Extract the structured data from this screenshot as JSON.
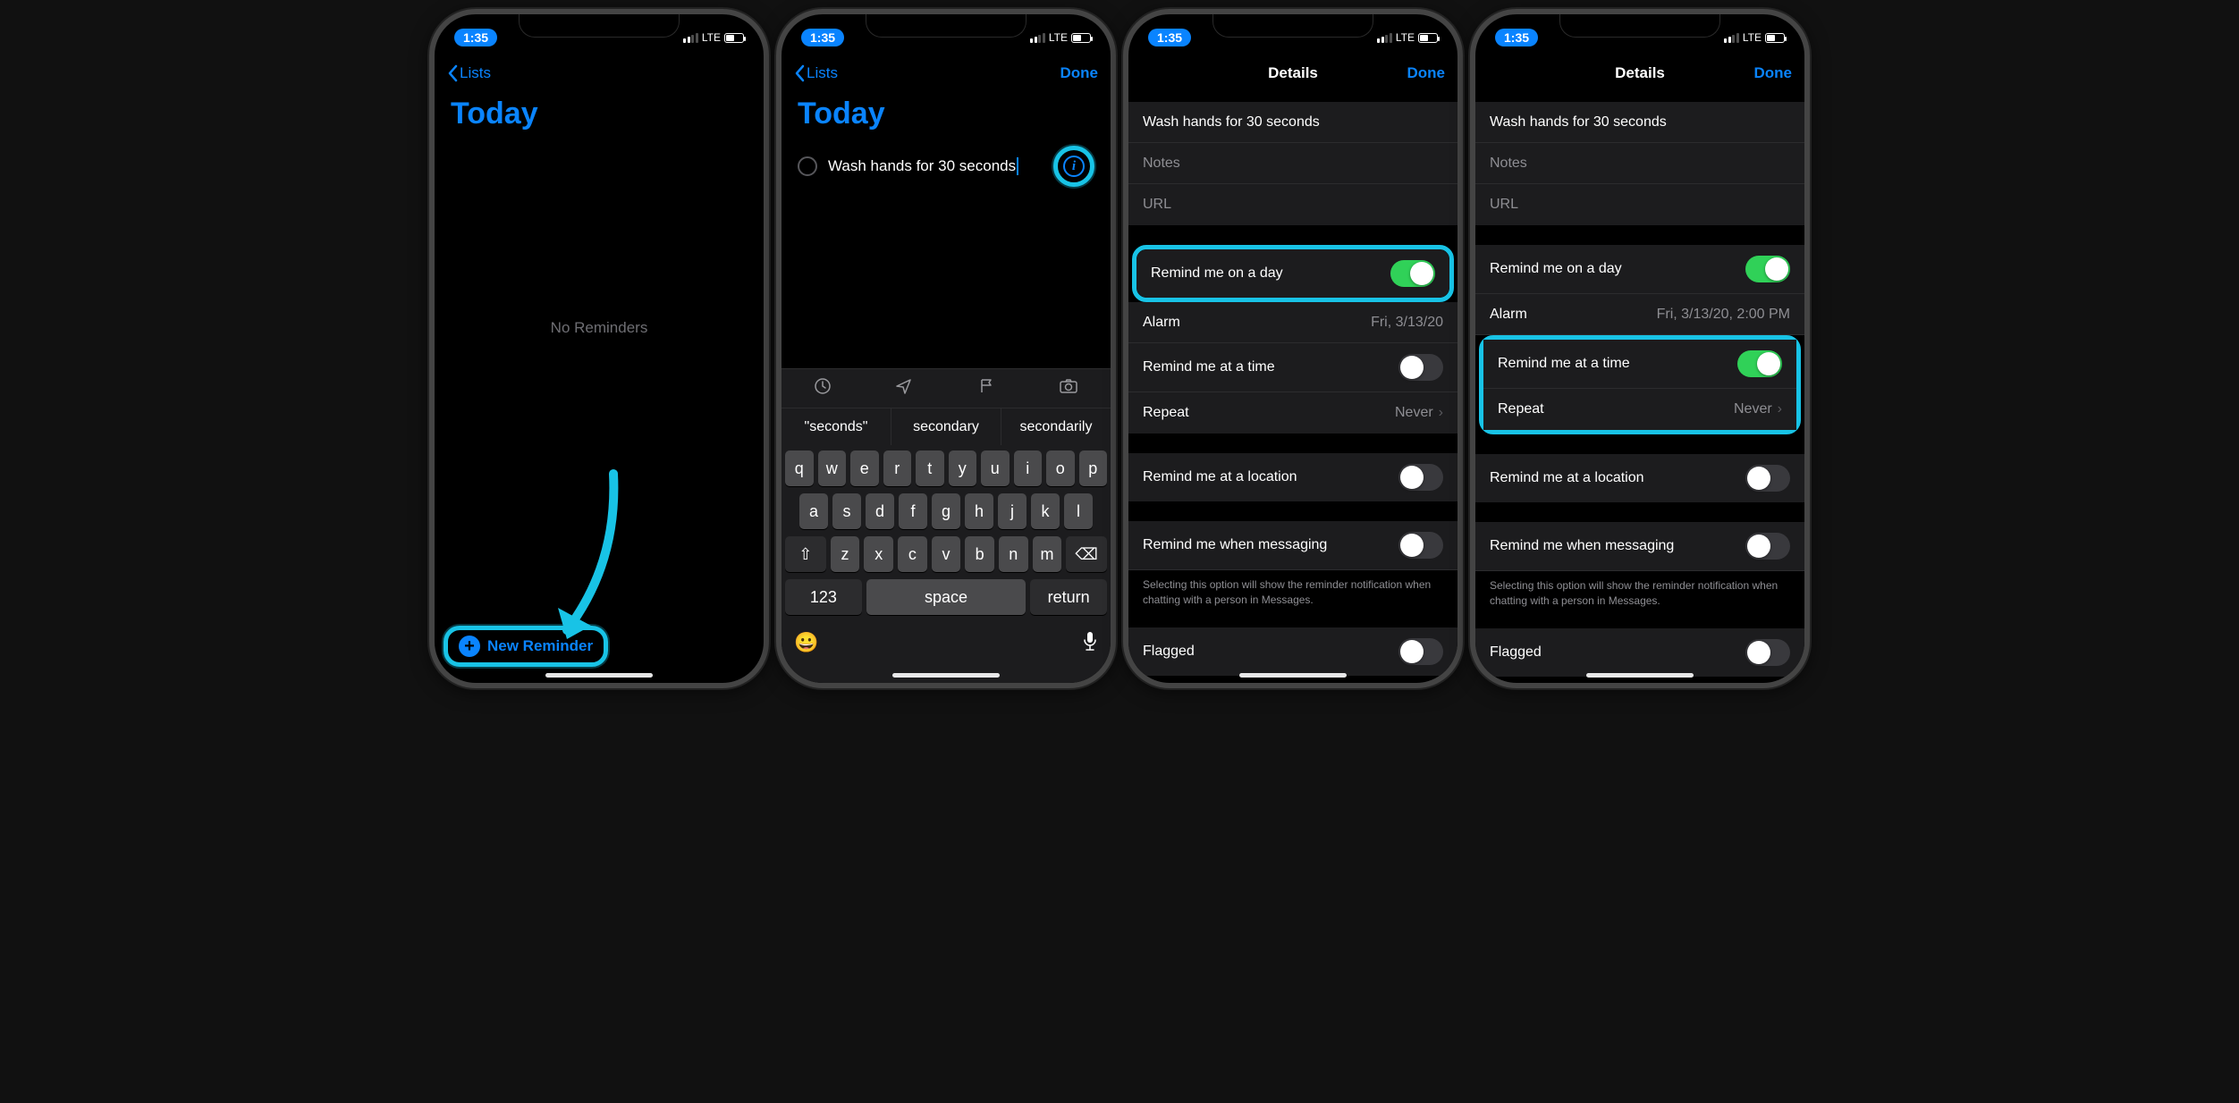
{
  "status": {
    "time": "1:35",
    "carrier": "LTE"
  },
  "s1": {
    "back": "Lists",
    "title": "Today",
    "empty": "No Reminders",
    "newReminder": "New Reminder"
  },
  "s2": {
    "back": "Lists",
    "done": "Done",
    "title": "Today",
    "reminderText": "Wash hands for 30 seconds",
    "suggest": [
      "\"seconds\"",
      "secondary",
      "secondarily"
    ],
    "keys123": "123",
    "keySpace": "space",
    "keyReturn": "return"
  },
  "s3": {
    "navTitle": "Details",
    "done": "Done",
    "titleField": "Wash hands for 30 seconds",
    "notes": "Notes",
    "url": "URL",
    "remindDay": "Remind me on a day",
    "alarm": "Alarm",
    "alarmValue": "Fri, 3/13/20",
    "remindTime": "Remind me at a time",
    "repeat": "Repeat",
    "repeatValue": "Never",
    "remindLoc": "Remind me at a location",
    "remindMsg": "Remind me when messaging",
    "msgFoot": "Selecting this option will show the reminder notification when chatting with a person in Messages.",
    "flagged": "Flagged"
  },
  "s4": {
    "navTitle": "Details",
    "done": "Done",
    "titleField": "Wash hands for 30 seconds",
    "notes": "Notes",
    "url": "URL",
    "remindDay": "Remind me on a day",
    "alarm": "Alarm",
    "alarmValue": "Fri, 3/13/20, 2:00 PM",
    "remindTime": "Remind me at a time",
    "repeat": "Repeat",
    "repeatValue": "Never",
    "remindLoc": "Remind me at a location",
    "remindMsg": "Remind me when messaging",
    "msgFoot": "Selecting this option will show the reminder notification when chatting with a person in Messages.",
    "flagged": "Flagged"
  }
}
